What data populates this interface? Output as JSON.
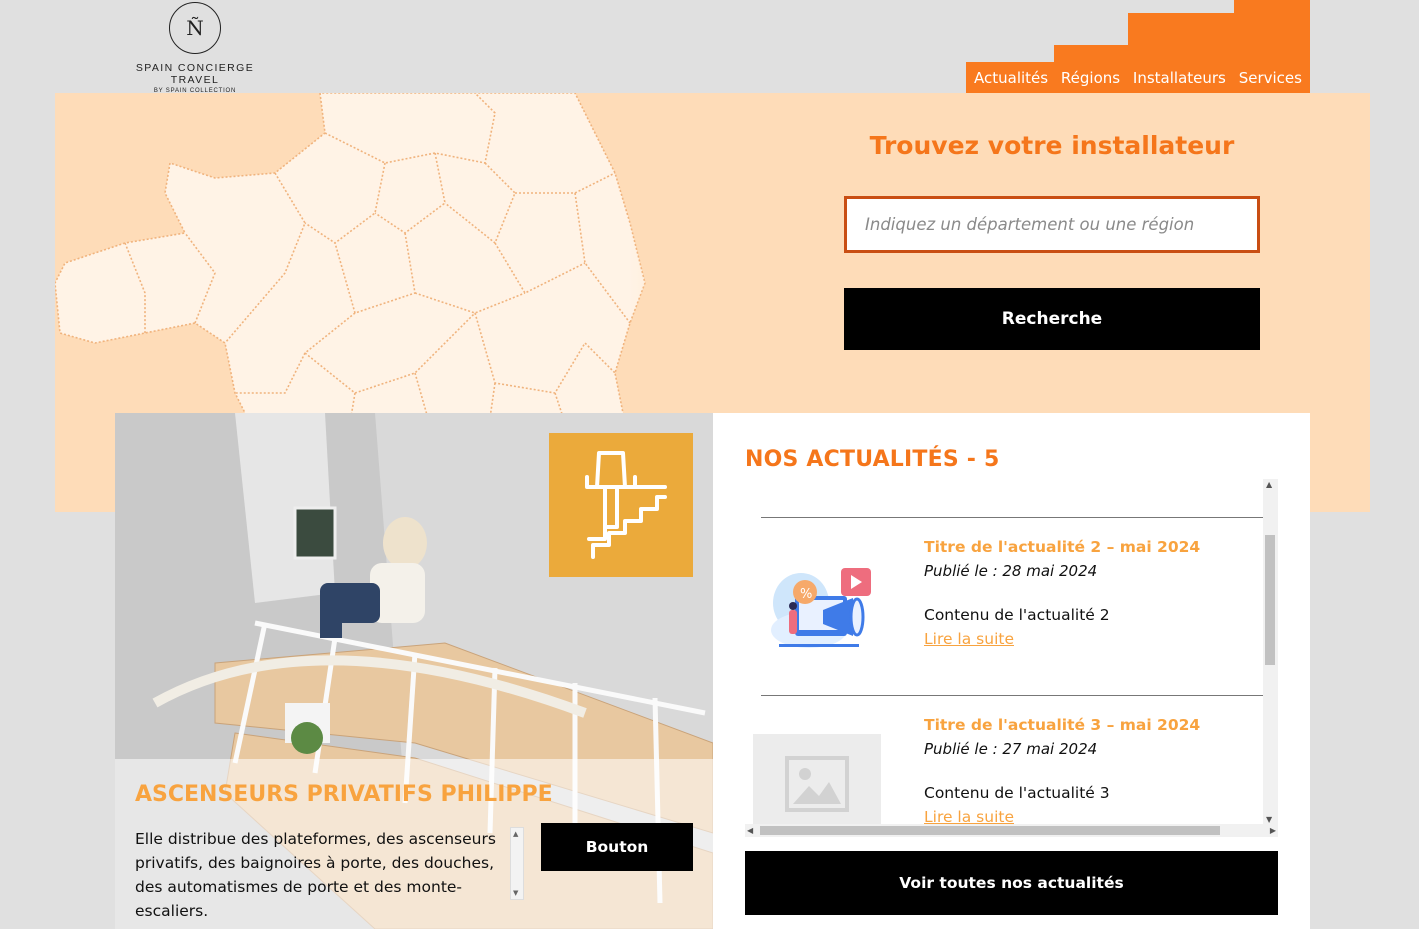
{
  "logo": {
    "monogram": "Ñ",
    "name": "SPAIN CONCIERGE TRAVEL",
    "subtitle": "BY SPAIN COLLECTION"
  },
  "nav": {
    "items": [
      "Actualités",
      "Régions",
      "Installateurs",
      "Services"
    ]
  },
  "hero": {
    "title": "Trouvez votre installateur",
    "search_placeholder": "Indiquez un département ou une région",
    "search_button": "Recherche"
  },
  "feature": {
    "title": "ASCENSEURS PRIVATIFS PHILIPPE",
    "text": "Elle distribue des plateformes, des ascenseurs privatifs, des baignoires à porte, des douches, des automatismes de porte et des monte-escaliers.",
    "button": "Bouton"
  },
  "news": {
    "heading": "NOS ACTUALITÉS - 5",
    "items": [
      {
        "title": "Titre de l'actualité 2 – mai 2024",
        "date": "Publié le : 28 mai 2024",
        "content": "Contenu de l'actualité 2",
        "link": "Lire la suite"
      },
      {
        "title": "Titre de l'actualité 3 – mai 2024",
        "date": "Publié le : 27 mai 2024",
        "content": "Contenu de l'actualité 3",
        "link": "Lire la suite"
      }
    ],
    "all_button": "Voir toutes nos actualités"
  },
  "colors": {
    "accent": "#f5761b",
    "hero_bg": "#fedcb8",
    "badge": "#ebaa3b",
    "link": "#f8a33f"
  },
  "icons": [
    "chairlift-icon",
    "megaphone-icon",
    "image-placeholder-icon"
  ]
}
